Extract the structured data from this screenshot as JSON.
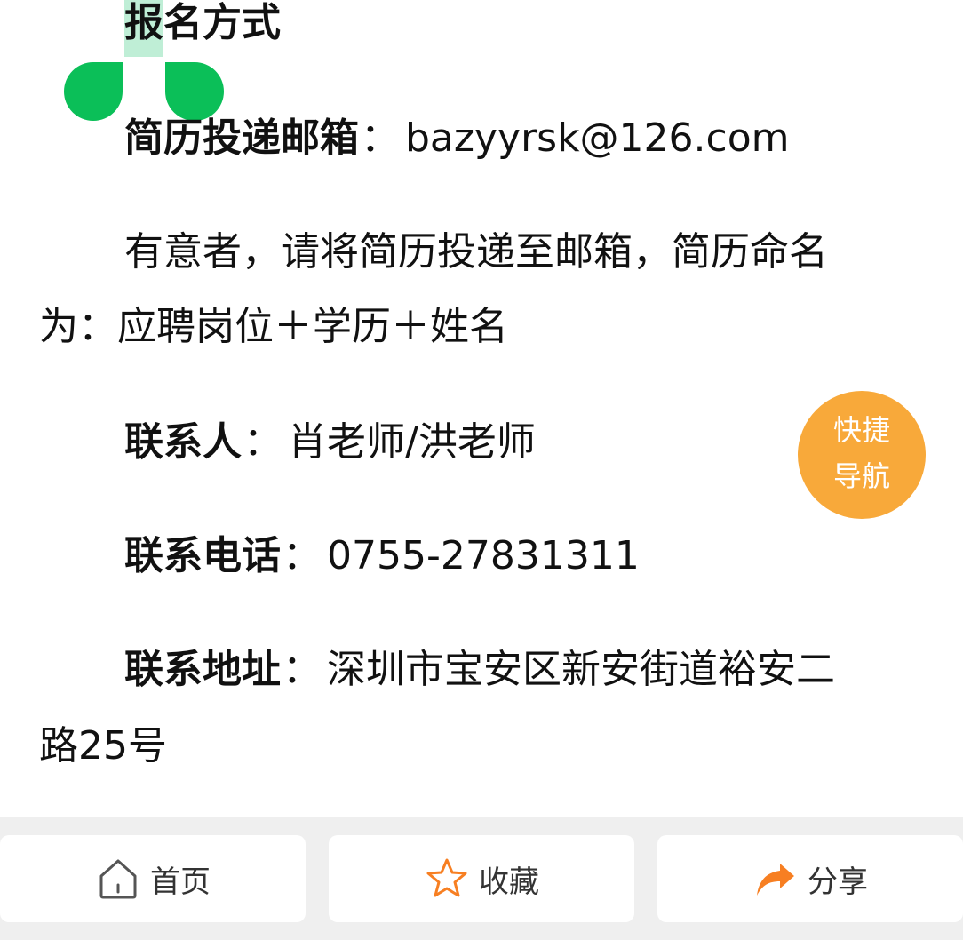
{
  "article": {
    "heading": {
      "first_char": "报",
      "rest": "名方式"
    },
    "email": {
      "label": "简历投递邮箱",
      "colon": "：",
      "value": "bazyyrsk@126.com"
    },
    "instruction": {
      "line1": "有意者，请将简历投递至邮箱，简历命名",
      "line2": "为：应聘岗位＋学历＋姓名"
    },
    "contact": {
      "label": "联系人",
      "colon": "：",
      "value": "肖老师/洪老师"
    },
    "phone": {
      "label": "联系电话",
      "colon": "：",
      "value": "0755-27831311"
    },
    "address": {
      "label": "联系地址",
      "colon": "：",
      "line1": "深圳市宝安区新安街道裕安二",
      "line2": "路25号"
    }
  },
  "quick_nav": {
    "line1": "快捷",
    "line2": "导航"
  },
  "bottom_bar": {
    "home_label": "首页",
    "favorite_label": "收藏",
    "share_label": "分享"
  },
  "colors": {
    "selection_handle": "#0bbf58",
    "selection_highlight": "#bfeed6",
    "quick_nav": "#f8a93a",
    "share_icon": "#f77f22",
    "favorite_icon": "#f77f22",
    "home_icon": "#555555"
  },
  "icons": {
    "home": "home-icon",
    "favorite": "star-icon",
    "share": "share-arrow-icon"
  }
}
